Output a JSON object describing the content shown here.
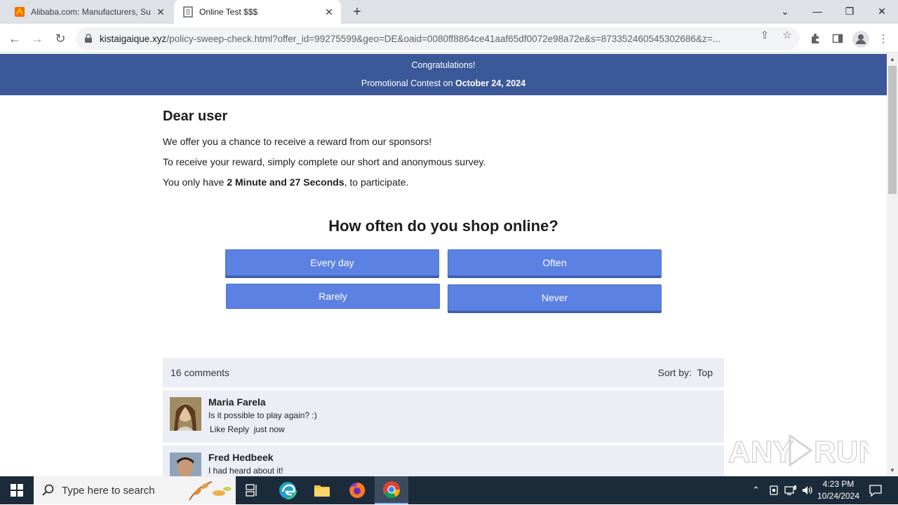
{
  "browser": {
    "tabs": [
      {
        "title": "Alibaba.com: Manufacturers, Su",
        "close": "✕"
      },
      {
        "title": "Online Test $$$",
        "close": "✕"
      }
    ],
    "new_tab": "+",
    "url_domain": "kistaigaique.xyz",
    "url_path": "/policy-sweep-check.html?offer_id=99275599&geo=DE&oaid=0080ff8864ce41aaf65df0072e98a72e&s=873352460545302686&z=..."
  },
  "banner": {
    "line1": "Congratulations!",
    "line2_prefix": "Promotional Contest on ",
    "line2_date": "October 24, 2024"
  },
  "intro": {
    "heading": "Dear user",
    "p1": "We offer you a chance to receive a reward from our sponsors!",
    "p2": "To receive your reward, simply complete our short and anonymous survey.",
    "p3_prefix": "You only have ",
    "p3_time": "2 Minute and 27 Seconds",
    "p3_suffix": ", to participate."
  },
  "survey": {
    "question": "How often do you shop online?",
    "answers": [
      "Every day",
      "Often",
      "Rarely",
      "Never"
    ]
  },
  "comments": {
    "count_label": "16 comments",
    "sort_label": "Sort by:",
    "sort_value": "Top",
    "items": [
      {
        "name": "Maria Farela",
        "text": "Is it possible to play again? :)",
        "actions": "Like Reply",
        "time": "just now"
      },
      {
        "name": "Fred Hedbeek",
        "text": "I had heard about it!",
        "actions": "",
        "time": ""
      }
    ]
  },
  "watermark": "ANY RUN",
  "taskbar": {
    "search_placeholder": "Type here to search",
    "time": "4:23 PM",
    "date": "10/24/2024"
  },
  "colors": {
    "banner": "#3b5998",
    "answer_button": "#5b81e2",
    "comments_bg": "#ebeef5",
    "taskbar": "#1c2b3a"
  }
}
